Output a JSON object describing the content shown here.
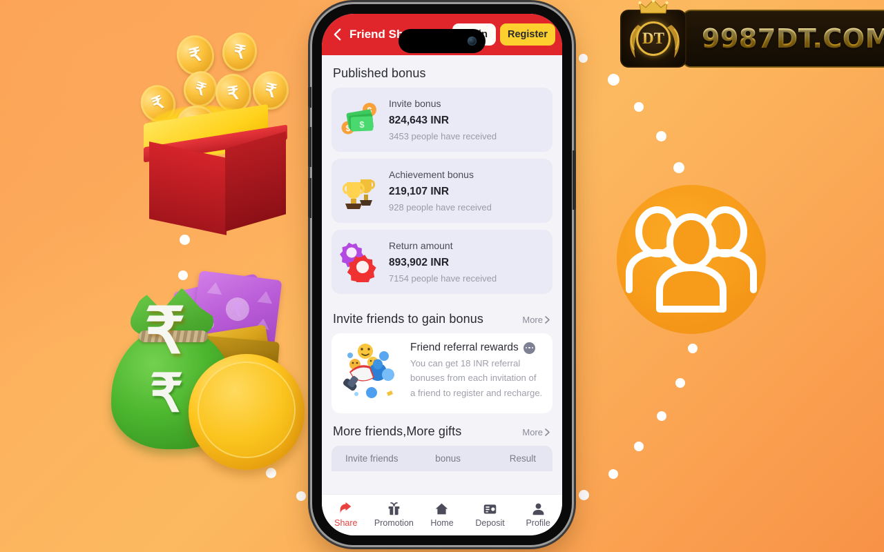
{
  "background": {
    "gradient_from": "#fb9c52",
    "gradient_to": "#f89246"
  },
  "brand_logo": {
    "crest_text": "DT",
    "domain_text": "9987DT.COM",
    "gold_color": "#e9bb45",
    "plate_color": "#130c03"
  },
  "illustrations": {
    "gift_box": "gift-box-with-rupee-coins",
    "money_bag": "money-bag-with-notes-and-rupee-coin",
    "group_icon": "three-people-group-icon",
    "currency_symbol": "₹"
  },
  "phone": {
    "header": {
      "back_icon": "chevron-left-icon",
      "title": "Friend Sharing",
      "login_label": "Login",
      "register_label": "Register",
      "bar_color": "#e0262b",
      "login_bg": "#fffdf7",
      "register_bg": "#fdd030"
    },
    "published": {
      "section_title": "Published bonus",
      "cards": [
        {
          "icon": "money-bills-icon",
          "name": "Invite bonus",
          "amount": "824,643 INR",
          "received": "3453 people have received"
        },
        {
          "icon": "trophy-icon",
          "name": "Achievement bonus",
          "amount": "219,107 INR",
          "received": "928 people have received"
        },
        {
          "icon": "gears-icon",
          "name": "Return amount",
          "amount": "893,902 INR",
          "received": "7154 people have received"
        }
      ]
    },
    "invite": {
      "section_title": "Invite friends to gain bonus",
      "more_label": "More",
      "card": {
        "icon": "megaphone-icon",
        "title": "Friend referral rewards",
        "badge_icon": "ellipsis-badge-icon",
        "description": "You can get 18 INR referral bonuses from each invitation of a friend to register and recharge."
      }
    },
    "gifts": {
      "section_title": "More friends,More gifts",
      "more_label": "More",
      "table_headers": [
        "Invite friends",
        "bonus",
        "Result"
      ]
    },
    "tabbar": {
      "active_color": "#e8413f",
      "items": [
        {
          "icon": "share-icon",
          "label": "Share",
          "active": true
        },
        {
          "icon": "gift-icon",
          "label": "Promotion",
          "active": false
        },
        {
          "icon": "home-icon",
          "label": "Home",
          "active": false
        },
        {
          "icon": "wallet-icon",
          "label": "Deposit",
          "active": false
        },
        {
          "icon": "person-icon",
          "label": "Profile",
          "active": false
        }
      ]
    }
  }
}
